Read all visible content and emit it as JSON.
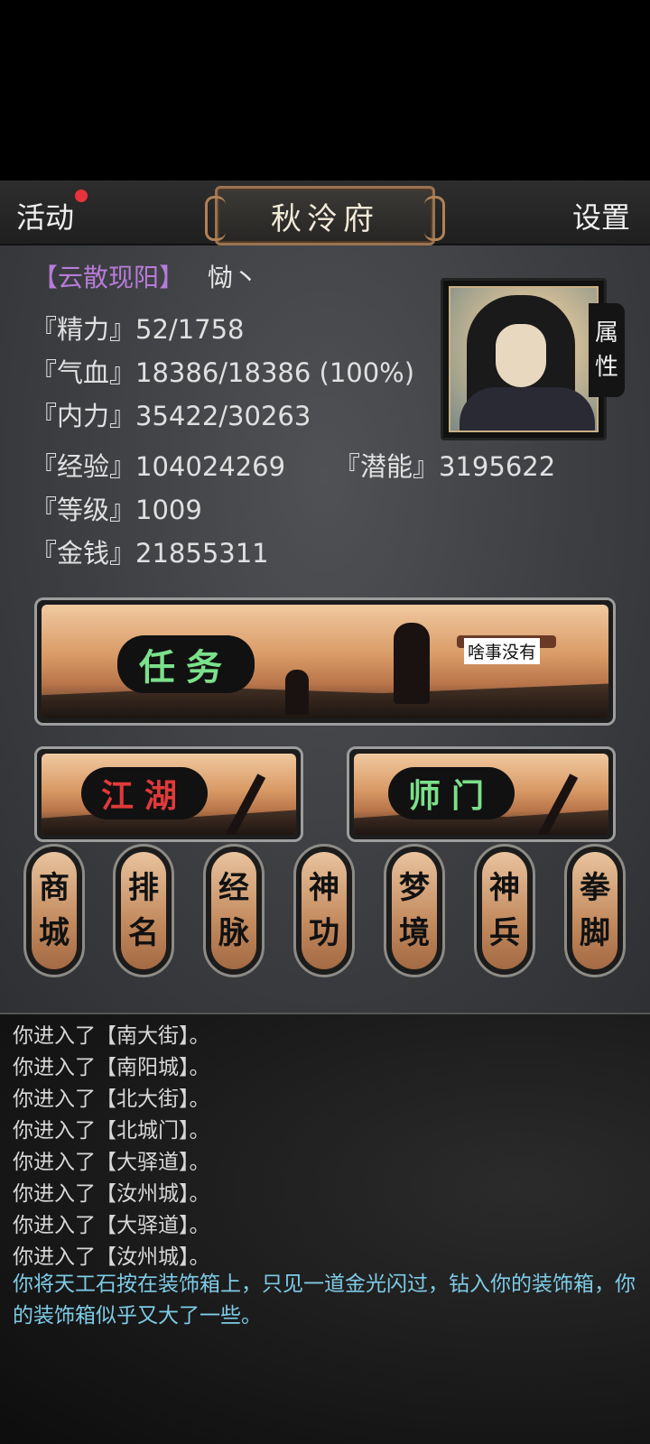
{
  "header": {
    "left_label": "活动",
    "title": "秋泠府",
    "right_label": "设置"
  },
  "player": {
    "faction": "【云散现阳】",
    "name": "恸丶"
  },
  "stats": {
    "jingli": {
      "label": "『精力』",
      "value": "52/1758"
    },
    "qixue": {
      "label": "『气血』",
      "value": "18386/18386 (100%)"
    },
    "neili": {
      "label": "『内力』",
      "value": "35422/30263"
    },
    "jingyan": {
      "label": "『经验』",
      "value": "104024269"
    },
    "qianneng": {
      "label": "『潜能』",
      "value": "3195622"
    },
    "dengji": {
      "label": "『等级』",
      "value": "1009"
    },
    "jinqian": {
      "label": "『金钱』",
      "value": "21855311"
    }
  },
  "attr_tab": {
    "line1": "属",
    "line2": "性"
  },
  "banners": {
    "task": {
      "label": "任务",
      "note": "啥事没有"
    },
    "jianghu": {
      "label": "江湖"
    },
    "shimen": {
      "label": "师门"
    }
  },
  "pillars": [
    {
      "top": "商",
      "bottom": "城"
    },
    {
      "top": "排",
      "bottom": "名"
    },
    {
      "top": "经",
      "bottom": "脉"
    },
    {
      "top": "神",
      "bottom": "功"
    },
    {
      "top": "梦",
      "bottom": "境"
    },
    {
      "top": "神",
      "bottom": "兵"
    },
    {
      "top": "拳",
      "bottom": "脚"
    }
  ],
  "log": {
    "lines": [
      "你进入了【南大街】。",
      "你进入了【南阳城】。",
      "你进入了【北大街】。",
      "你进入了【北城门】。",
      "你进入了【大驿道】。",
      "你进入了【汝州城】。",
      "你进入了【大驿道】。",
      "你进入了【汝州城】。"
    ],
    "highlight": "你将天工石按在装饰箱上，只见一道金光闪过，钻入你的装饰箱，你的装饰箱似乎又大了一些。"
  }
}
